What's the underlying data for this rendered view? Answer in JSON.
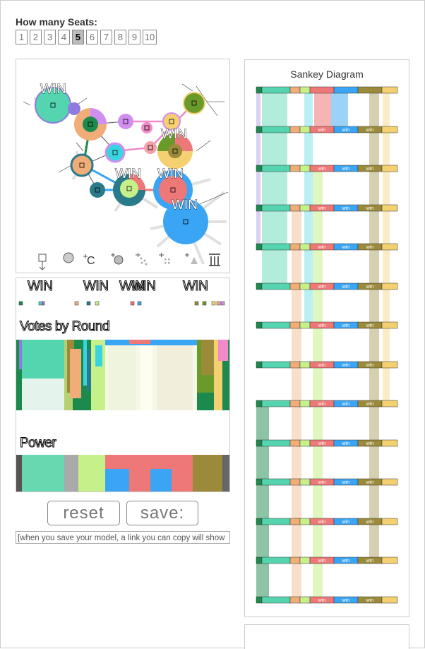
{
  "seats": {
    "label": "How many Seats:",
    "options": [
      "1",
      "2",
      "3",
      "4",
      "5",
      "6",
      "7",
      "8",
      "9",
      "10"
    ],
    "selected": "5"
  },
  "graph": {
    "win_labels": [
      "WIN",
      "WIN",
      "WIN",
      "WIN",
      "WIN"
    ],
    "toolbar_icons": [
      "candidate-icon",
      "voter-icon",
      "add-candidate-icon",
      "add-voter-icon",
      "add-crowd-icon",
      "add-grid-icon",
      "add-triangle-icon",
      "delete-icon"
    ],
    "toolbar_glyph_c": "C"
  },
  "votes": {
    "win_labels": [
      "WIN",
      "WIN",
      "WIN",
      "WIN",
      "WIN"
    ],
    "title": "Votes by Round",
    "power_title": "Power"
  },
  "buttons": {
    "reset": "reset",
    "save": "save:"
  },
  "note": "[when you save your model, a link you can copy will show",
  "sankey": {
    "title": "Sankey Diagram",
    "win_label": "win"
  },
  "colors": {
    "teal": "#55d4b0",
    "purple": "#8e7ae0",
    "orange": "#f0ad78",
    "darkgreen": "#1b8a4c",
    "lime": "#c6f08a",
    "salmon": "#ee7777",
    "blue": "#3aa5f5",
    "olive": "#9a8a3a",
    "pink": "#f08ac8",
    "yellow": "#f5d070"
  }
}
